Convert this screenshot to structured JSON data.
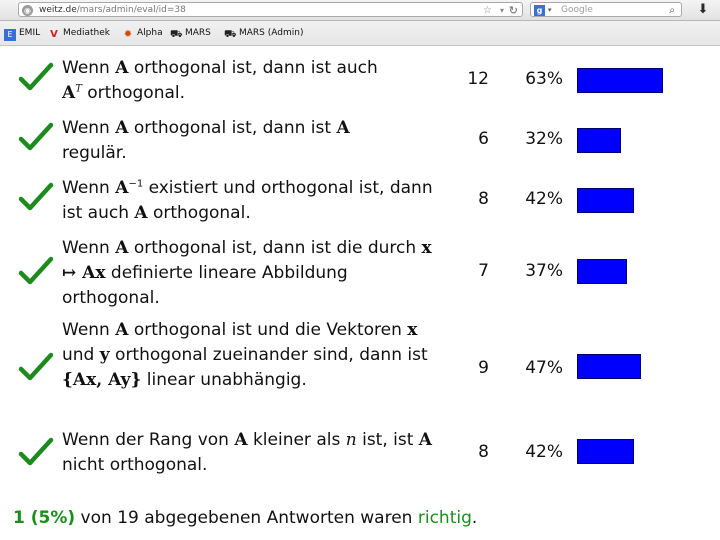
{
  "browser": {
    "url_host": "weitz.de",
    "url_path": "/mars/admin/eval/id=38",
    "search_placeholder": "Google",
    "search_engine_icon": "google-icon"
  },
  "bookmarks": [
    {
      "label": "EMIL",
      "icon": "emil-icon"
    },
    {
      "label": "Mediathek",
      "icon": "mediathek-icon"
    },
    {
      "label": "Alpha",
      "icon": "alpha-icon"
    },
    {
      "label": "MARS",
      "icon": "mars-icon"
    },
    {
      "label": "MARS (Admin)",
      "icon": "mars-icon"
    }
  ],
  "answers": [
    {
      "parts": [
        "Wenn ",
        "A",
        " orthogonal ist, dann ist auch ",
        "A",
        "T",
        " orthogonal."
      ],
      "count": "12",
      "percent": "63%",
      "fraction": 0.63
    },
    {
      "parts": [
        "Wenn ",
        "A",
        " orthogonal ist, dann ist ",
        "A",
        " regulär."
      ],
      "count": "6",
      "percent": "32%",
      "fraction": 0.32
    },
    {
      "parts": [
        "Wenn ",
        "A",
        "−1",
        " existiert und orthogonal ist, dann ist auch ",
        "A",
        " orthogonal."
      ],
      "count": "8",
      "percent": "42%",
      "fraction": 0.42
    },
    {
      "parts": [
        "Wenn ",
        "A",
        " orthogonal ist, dann ist die durch ",
        "x ↦ Ax",
        " definierte lineare Abbildung orthogonal."
      ],
      "count": "7",
      "percent": "37%",
      "fraction": 0.37
    },
    {
      "parts": [
        "Wenn ",
        "A",
        " orthogonal ist und die Vektoren ",
        "x",
        " und ",
        "y",
        " orthogonal zueinander sind, dann ist ",
        "{Ax, Ay}",
        " linear unabhängig."
      ],
      "count": "9",
      "percent": "47%",
      "fraction": 0.47
    },
    {
      "parts": [
        "Wenn der Rang von ",
        "A",
        " kleiner als ",
        "n",
        " ist, ist ",
        "A",
        " nicht orthogonal."
      ],
      "count": "8",
      "percent": "42%",
      "fraction": 0.42
    }
  ],
  "summary": {
    "correct": "1 (5%)",
    "middle": " von 19 abgegebenen Antworten waren ",
    "word": "richtig",
    "end": "."
  },
  "colors": {
    "check": "#1c8a1c",
    "bar": "#0000ff",
    "summary_green": "#1a8f1a"
  }
}
